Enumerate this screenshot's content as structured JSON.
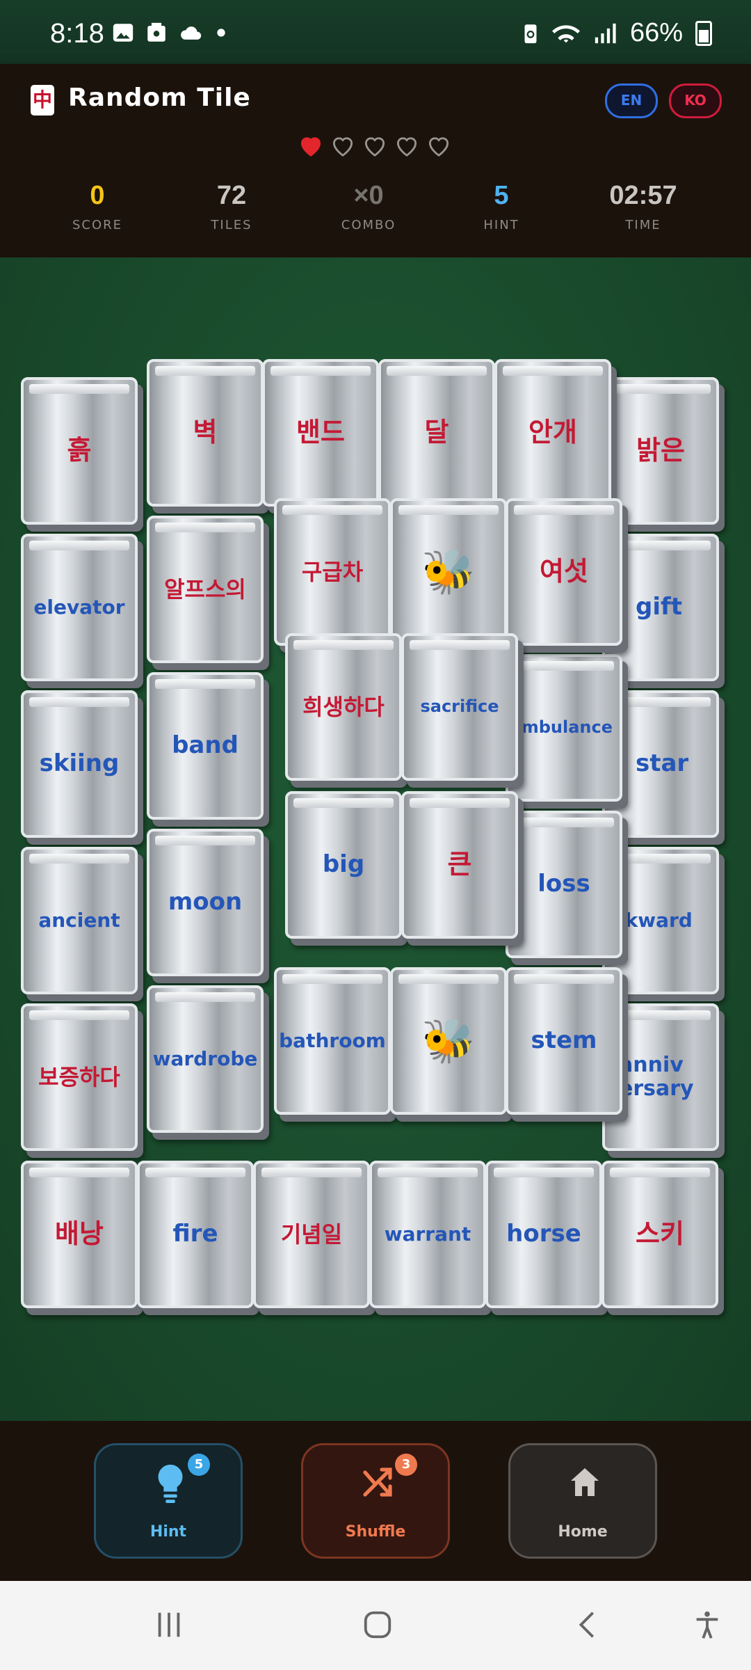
{
  "status_bar": {
    "time": "8:18",
    "battery": "66%",
    "icons": [
      "image-icon",
      "gallery-icon",
      "cloud-icon",
      "dot-icon",
      "battery-saver-icon",
      "wifi-icon",
      "signal-icon",
      "battery-icon"
    ]
  },
  "header": {
    "logo_glyph": "中",
    "title": "Random Tile",
    "lang_en": "EN",
    "lang_ko": "KO",
    "lives_total": 5,
    "lives_filled": 1
  },
  "stats": [
    {
      "value": "0",
      "label": "SCORE",
      "color": "#f5c518"
    },
    {
      "value": "72",
      "label": "TILES",
      "color": "#c9c6c2"
    },
    {
      "value": "×0",
      "label": "COMBO",
      "color": "#77736f"
    },
    {
      "value": "5",
      "label": "HINT",
      "color": "#4fb3f0"
    },
    {
      "value": "02:57",
      "label": "TIME",
      "color": "#c9c6c2"
    }
  ],
  "tiles": {
    "r1": [
      "흙",
      "벽",
      "밴드",
      "달",
      "안개",
      "밝은"
    ],
    "r2": [
      "elevator",
      "알프스의",
      "구급차",
      "bee",
      "여섯",
      "gift"
    ],
    "r3": [
      "skiing",
      "band",
      "희생하다",
      "sacrifice",
      "mbulance",
      "star"
    ],
    "r4": [
      "ancient",
      "moon",
      "big",
      "큰",
      "loss",
      "ckward"
    ],
    "r5": [
      "보증하다",
      "wardrobe",
      "bathroom",
      "bee",
      "stem",
      "anniv ersary"
    ],
    "r6": [
      "배낭",
      "fire",
      "기념일",
      "warrant",
      "horse",
      "스키"
    ]
  },
  "actions": {
    "hint": {
      "label": "Hint",
      "badge": "5"
    },
    "shuffle": {
      "label": "Shuffle",
      "badge": "3"
    },
    "home": {
      "label": "Home"
    }
  },
  "colors": {
    "accent_red": "#c41934",
    "accent_blue": "#2456b8",
    "board_green": "#1a4a2c",
    "header_dark": "#1c120c"
  }
}
